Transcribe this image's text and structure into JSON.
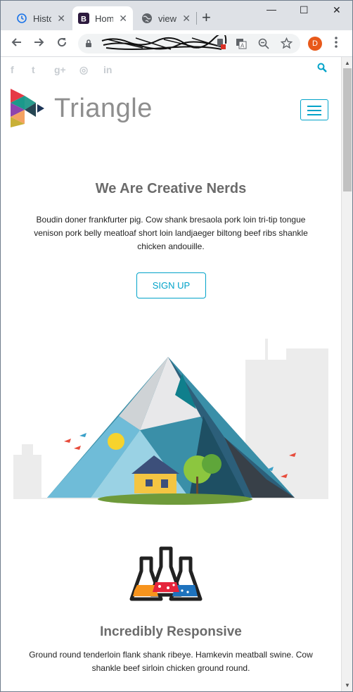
{
  "browser": {
    "tabs": [
      {
        "title": "History",
        "close": "✕"
      },
      {
        "title": "Home",
        "close": "✕"
      },
      {
        "title": "view-source",
        "close": "✕"
      }
    ],
    "new_tab": "+",
    "window_controls": {
      "minimize": "—",
      "maximize": "☐",
      "close": "✕"
    },
    "profile_initial": "D"
  },
  "header": {
    "social_icons": [
      "facebook-icon",
      "twitter-icon",
      "google-plus-icon",
      "dribbble-icon",
      "linkedin-icon"
    ],
    "social_glyphs": {
      "facebook": "f",
      "twitter": "t",
      "google": "g+",
      "dribbble": "◎",
      "linkedin": "in"
    },
    "brand": "Triangle",
    "accent_color": "#02a3c9"
  },
  "hero": {
    "title": "We Are Creative Nerds",
    "text": "Boudin doner frankfurter pig. Cow shank bresaola pork loin tri-tip tongue venison pork belly meatloaf short loin landjaeger biltong beef ribs shankle chicken andouille.",
    "cta": "SIGN UP"
  },
  "feature": {
    "title": "Incredibly Responsive",
    "text": "Ground round tenderloin flank shank ribeye. Hamkevin meatball swine. Cow shankle beef sirloin chicken ground round."
  }
}
